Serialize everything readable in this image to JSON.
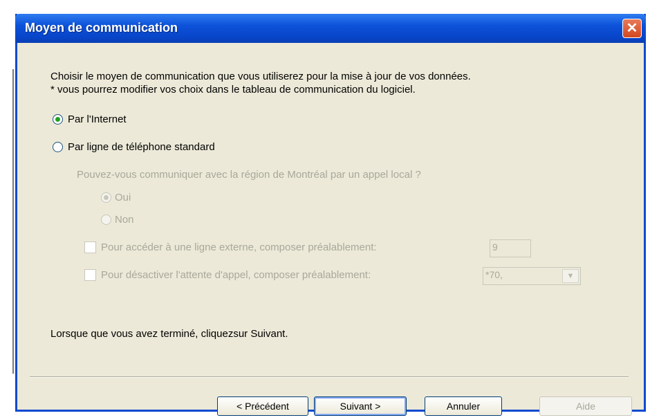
{
  "window": {
    "title": "Moyen de communication",
    "close_glyph": "✕"
  },
  "intro": {
    "line1": "Choisir le moyen de communication que vous utiliserez pour la mise à jour de vos données.",
    "line2": "* vous pourrez modifier vos choix dans le tableau de communication du logiciel."
  },
  "options": {
    "internet": {
      "label": "Par l'Internet",
      "selected": true
    },
    "phone": {
      "label": "Par ligne de téléphone standard",
      "selected": false
    }
  },
  "phone_settings": {
    "question": "Pouvez-vous communiquer avec la région de Montréal par un appel local ?",
    "oui": {
      "label": "Oui",
      "selected": true
    },
    "non": {
      "label": "Non",
      "selected": false
    },
    "external_line": {
      "label": "Pour accéder à une ligne externe, composer préalablement:",
      "value": "9"
    },
    "call_waiting": {
      "label": "Pour désactiver l'attente d'appel, composer préalablement:",
      "value": "*70,"
    }
  },
  "footer_text": "Lorsque que vous avez terminé, cliquezsur Suivant.",
  "buttons": {
    "previous": "< Précédent",
    "next": "Suivant >",
    "cancel": "Annuler",
    "help": "Aide"
  },
  "colors": {
    "titlebar": "#0845c9",
    "radio_dot": "#21a121",
    "disabled_text": "#a8a89a",
    "dialog_bg": "#ece9d8"
  }
}
